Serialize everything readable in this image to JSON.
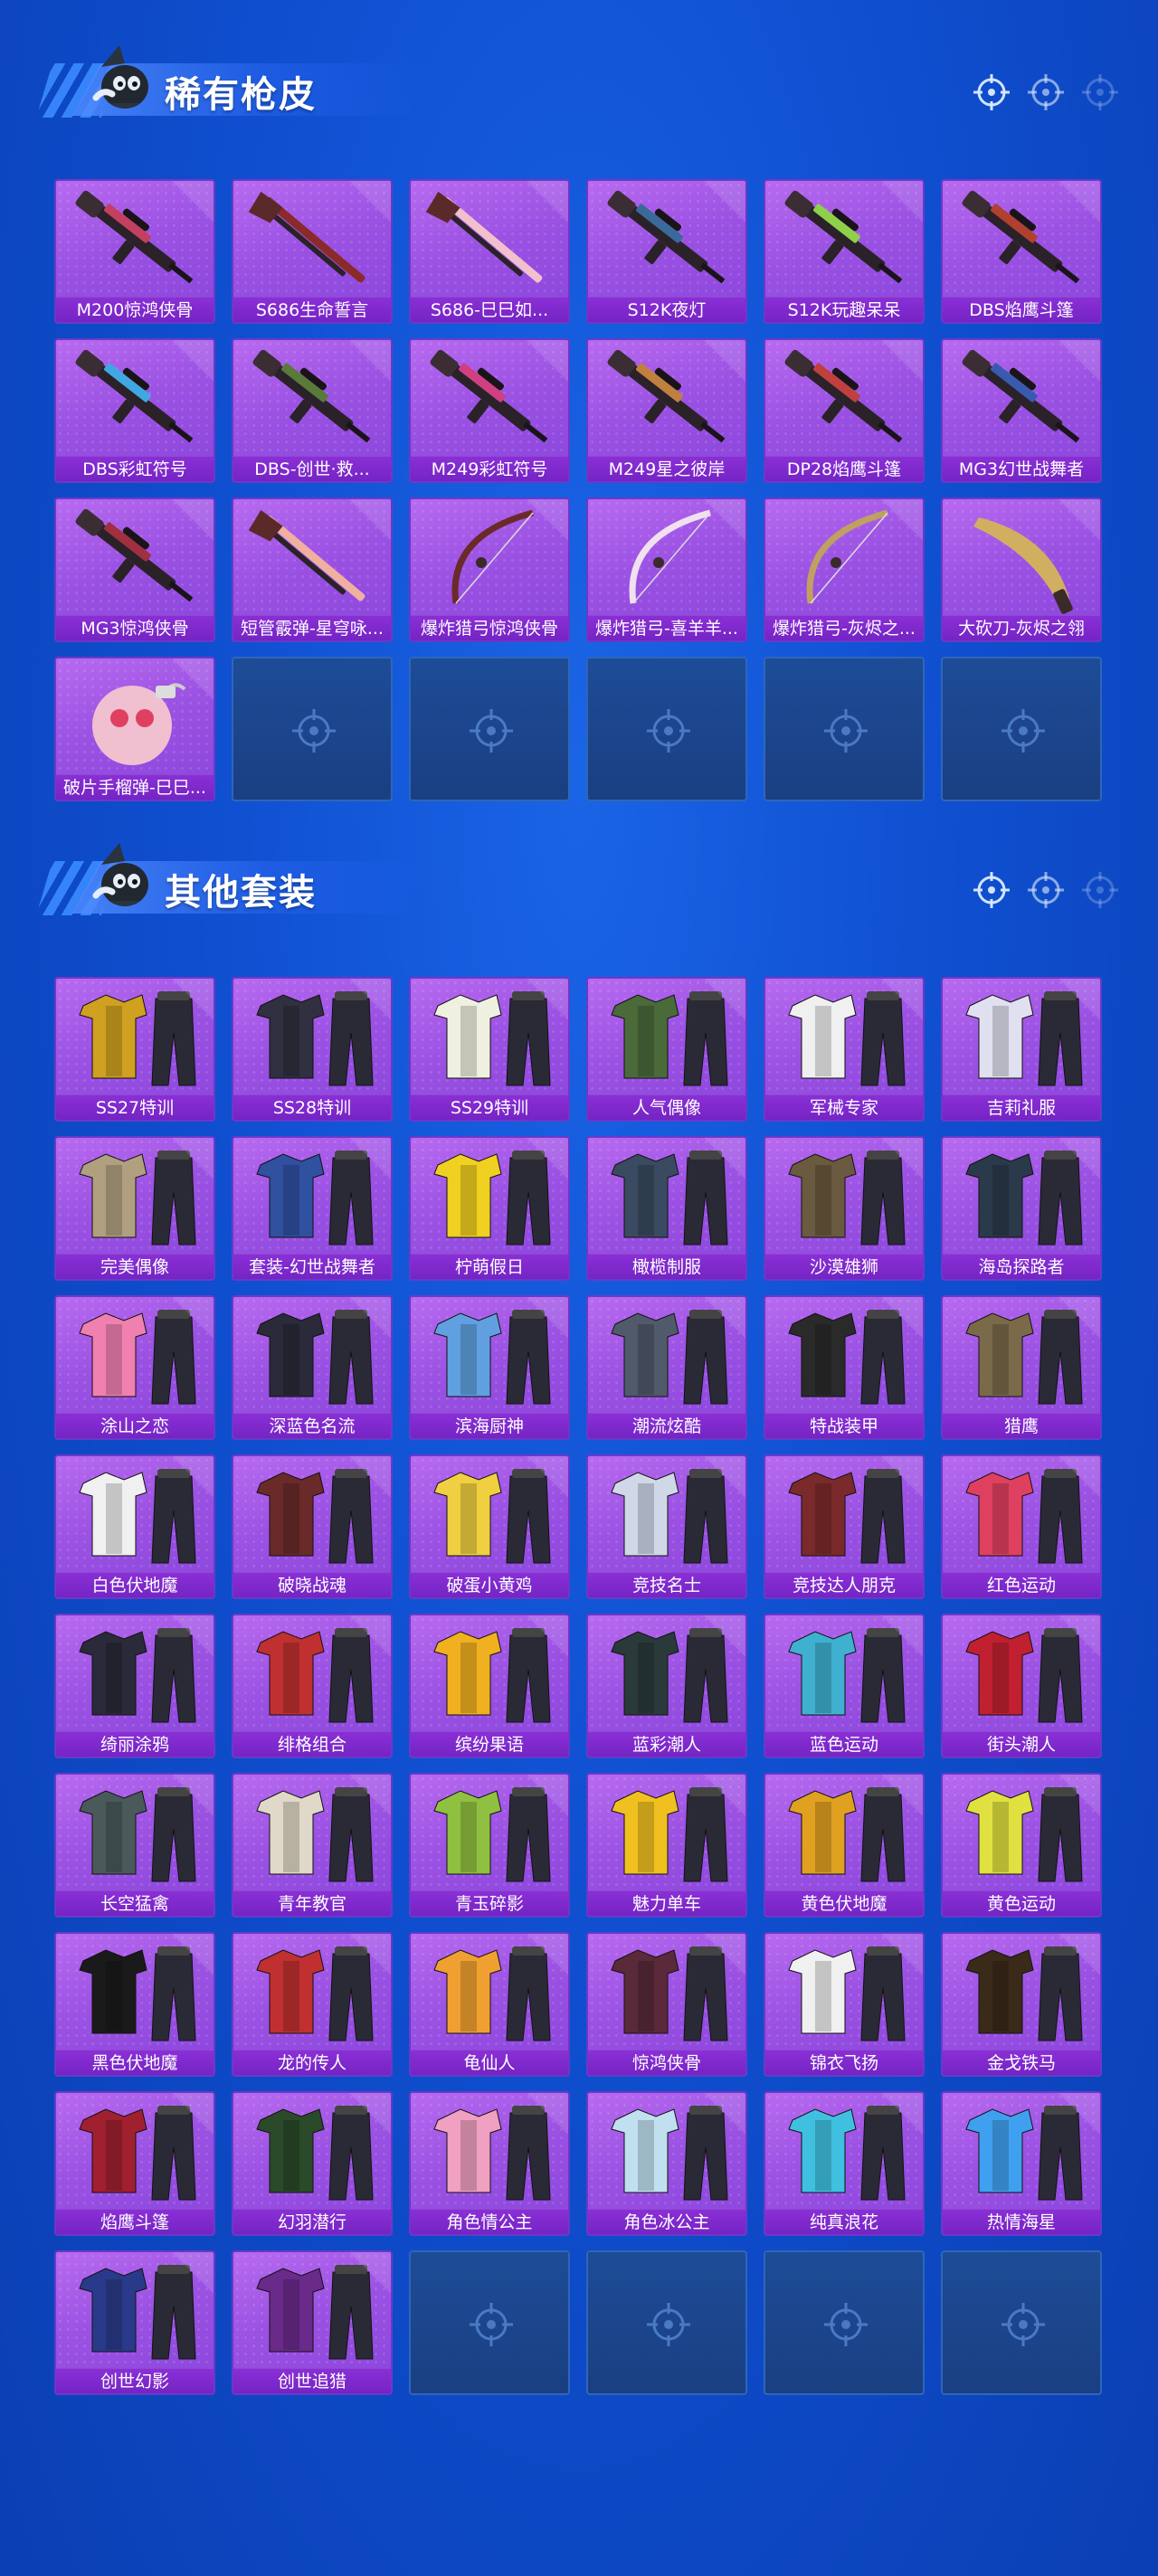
{
  "sections": [
    {
      "title": "稀有枪皮",
      "items": [
        {
          "label": "M200惊鸿侠骨",
          "kind": "rifle",
          "accent": "#c44060"
        },
        {
          "label": "S686生命誓言",
          "kind": "shotgun",
          "accent": "#8a2a2a"
        },
        {
          "label": "S686-巳巳如...",
          "kind": "shotgun",
          "accent": "#f2c0cc"
        },
        {
          "label": "S12K夜灯",
          "kind": "rifle",
          "accent": "#3a6a9a"
        },
        {
          "label": "S12K玩趣呆呆",
          "kind": "rifle",
          "accent": "#8fd04a"
        },
        {
          "label": "DBS焰鹰斗篷",
          "kind": "rifle",
          "accent": "#b04030"
        },
        {
          "label": "DBS彩虹符号",
          "kind": "rifle",
          "accent": "#40a8e0"
        },
        {
          "label": "DBS-创世·救...",
          "kind": "rifle",
          "accent": "#5a7a3a"
        },
        {
          "label": "M249彩虹符号",
          "kind": "rifle",
          "accent": "#d04080"
        },
        {
          "label": "M249星之彼岸",
          "kind": "rifle",
          "accent": "#c08040"
        },
        {
          "label": "DP28焰鹰斗篷",
          "kind": "rifle",
          "accent": "#c04040"
        },
        {
          "label": "MG3幻世战舞者",
          "kind": "rifle",
          "accent": "#3a5ab0"
        },
        {
          "label": "MG3惊鸿侠骨",
          "kind": "rifle",
          "accent": "#a03040"
        },
        {
          "label": "短管霰弹-星穹咏...",
          "kind": "shotgun",
          "accent": "#f0b0a0"
        },
        {
          "label": "爆炸猎弓惊鸿侠骨",
          "kind": "bow",
          "accent": "#6a2a2a"
        },
        {
          "label": "爆炸猎弓-喜羊羊...",
          "kind": "bow",
          "accent": "#f0e0f0"
        },
        {
          "label": "爆炸猎弓-灰烬之...",
          "kind": "bow",
          "accent": "#c0a060"
        },
        {
          "label": "大砍刀-灰烬之翎",
          "kind": "blade",
          "accent": "#d0b060"
        },
        {
          "label": "破片手榴弹-巳巳...",
          "kind": "grenade",
          "accent": "#f0c0d0"
        },
        {
          "label": "",
          "kind": "empty"
        },
        {
          "label": "",
          "kind": "empty"
        },
        {
          "label": "",
          "kind": "empty"
        },
        {
          "label": "",
          "kind": "empty"
        },
        {
          "label": "",
          "kind": "empty"
        }
      ]
    },
    {
      "title": "其他套装",
      "items": [
        {
          "label": "SS27特训",
          "kind": "outfit",
          "accent": "#d0a020"
        },
        {
          "label": "SS28特训",
          "kind": "outfit",
          "accent": "#303040"
        },
        {
          "label": "SS29特训",
          "kind": "outfit",
          "accent": "#f0f0e0"
        },
        {
          "label": "人气偶像",
          "kind": "outfit",
          "accent": "#4a6a3a"
        },
        {
          "label": "军械专家",
          "kind": "outfit",
          "accent": "#f0f0f0"
        },
        {
          "label": "吉莉礼服",
          "kind": "outfit",
          "accent": "#e0e0f0"
        },
        {
          "label": "完美偶像",
          "kind": "outfit",
          "accent": "#b0a080"
        },
        {
          "label": "套装-幻世战舞者",
          "kind": "outfit",
          "accent": "#3050a0"
        },
        {
          "label": "柠萌假日",
          "kind": "outfit",
          "accent": "#f0d020"
        },
        {
          "label": "橄榄制服",
          "kind": "outfit",
          "accent": "#3a4a60"
        },
        {
          "label": "沙漠雄狮",
          "kind": "outfit",
          "accent": "#6a5a40"
        },
        {
          "label": "海岛探路者",
          "kind": "outfit",
          "accent": "#2a3a4a"
        },
        {
          "label": "涂山之恋",
          "kind": "outfit",
          "accent": "#f080b0"
        },
        {
          "label": "深蓝色名流",
          "kind": "outfit",
          "accent": "#2a2a3a"
        },
        {
          "label": "滨海厨神",
          "kind": "outfit",
          "accent": "#60a0e0"
        },
        {
          "label": "潮流炫酷",
          "kind": "outfit",
          "accent": "#505a6a"
        },
        {
          "label": "特战装甲",
          "kind": "outfit",
          "accent": "#2a2a2a"
        },
        {
          "label": "猎鹰",
          "kind": "outfit",
          "accent": "#7a6a4a"
        },
        {
          "label": "白色伏地魔",
          "kind": "outfit",
          "accent": "#f0f0f0"
        },
        {
          "label": "破晓战魂",
          "kind": "outfit",
          "accent": "#6a2a2a"
        },
        {
          "label": "破蛋小黄鸡",
          "kind": "outfit",
          "accent": "#f0d040"
        },
        {
          "label": "竞技名士",
          "kind": "outfit",
          "accent": "#d0d8e8"
        },
        {
          "label": "竞技达人朋克",
          "kind": "outfit",
          "accent": "#7a2a2a"
        },
        {
          "label": "红色运动",
          "kind": "outfit",
          "accent": "#e04060"
        },
        {
          "label": "绮丽涂鸦",
          "kind": "outfit",
          "accent": "#2a2a3a"
        },
        {
          "label": "绯格组合",
          "kind": "outfit",
          "accent": "#c03030"
        },
        {
          "label": "缤纷果语",
          "kind": "outfit",
          "accent": "#f0b020"
        },
        {
          "label": "蓝彩潮人",
          "kind": "outfit",
          "accent": "#2a3a3a"
        },
        {
          "label": "蓝色运动",
          "kind": "outfit",
          "accent": "#40b0d0"
        },
        {
          "label": "街头潮人",
          "kind": "outfit",
          "accent": "#c02030"
        },
        {
          "label": "长空猛禽",
          "kind": "outfit",
          "accent": "#4a5a5a"
        },
        {
          "label": "青年教官",
          "kind": "outfit",
          "accent": "#e0d8c8"
        },
        {
          "label": "青玉碎影",
          "kind": "outfit",
          "accent": "#90c040"
        },
        {
          "label": "魅力单车",
          "kind": "outfit",
          "accent": "#f0c020"
        },
        {
          "label": "黄色伏地魔",
          "kind": "outfit",
          "accent": "#e0a020"
        },
        {
          "label": "黄色运动",
          "kind": "outfit",
          "accent": "#e0e040"
        },
        {
          "label": "黑色伏地魔",
          "kind": "outfit",
          "accent": "#1a1a1a"
        },
        {
          "label": "龙的传人",
          "kind": "outfit",
          "accent": "#c03030"
        },
        {
          "label": "龟仙人",
          "kind": "outfit",
          "accent": "#f0a030"
        },
        {
          "label": "惊鸿侠骨",
          "kind": "outfit",
          "accent": "#5a2a3a"
        },
        {
          "label": "锦衣飞扬",
          "kind": "outfit",
          "accent": "#f0f0f0"
        },
        {
          "label": "金戈铁马",
          "kind": "outfit",
          "accent": "#3a2a1a"
        },
        {
          "label": "焰鹰斗篷",
          "kind": "outfit",
          "accent": "#a02030"
        },
        {
          "label": "幻羽潜行",
          "kind": "outfit",
          "accent": "#2a4a2a"
        },
        {
          "label": "角色情公主",
          "kind": "outfit",
          "accent": "#f0a0c0"
        },
        {
          "label": "角色冰公主",
          "kind": "outfit",
          "accent": "#c0e0f0"
        },
        {
          "label": "纯真浪花",
          "kind": "outfit",
          "accent": "#40c0e0"
        },
        {
          "label": "热情海星",
          "kind": "outfit",
          "accent": "#40a0f0"
        },
        {
          "label": "创世幻影",
          "kind": "outfit",
          "accent": "#2a3a8a"
        },
        {
          "label": "创世追猎",
          "kind": "outfit",
          "accent": "#6a2a8a"
        },
        {
          "label": "",
          "kind": "empty"
        },
        {
          "label": "",
          "kind": "empty"
        },
        {
          "label": "",
          "kind": "empty"
        },
        {
          "label": "",
          "kind": "empty"
        }
      ]
    }
  ]
}
